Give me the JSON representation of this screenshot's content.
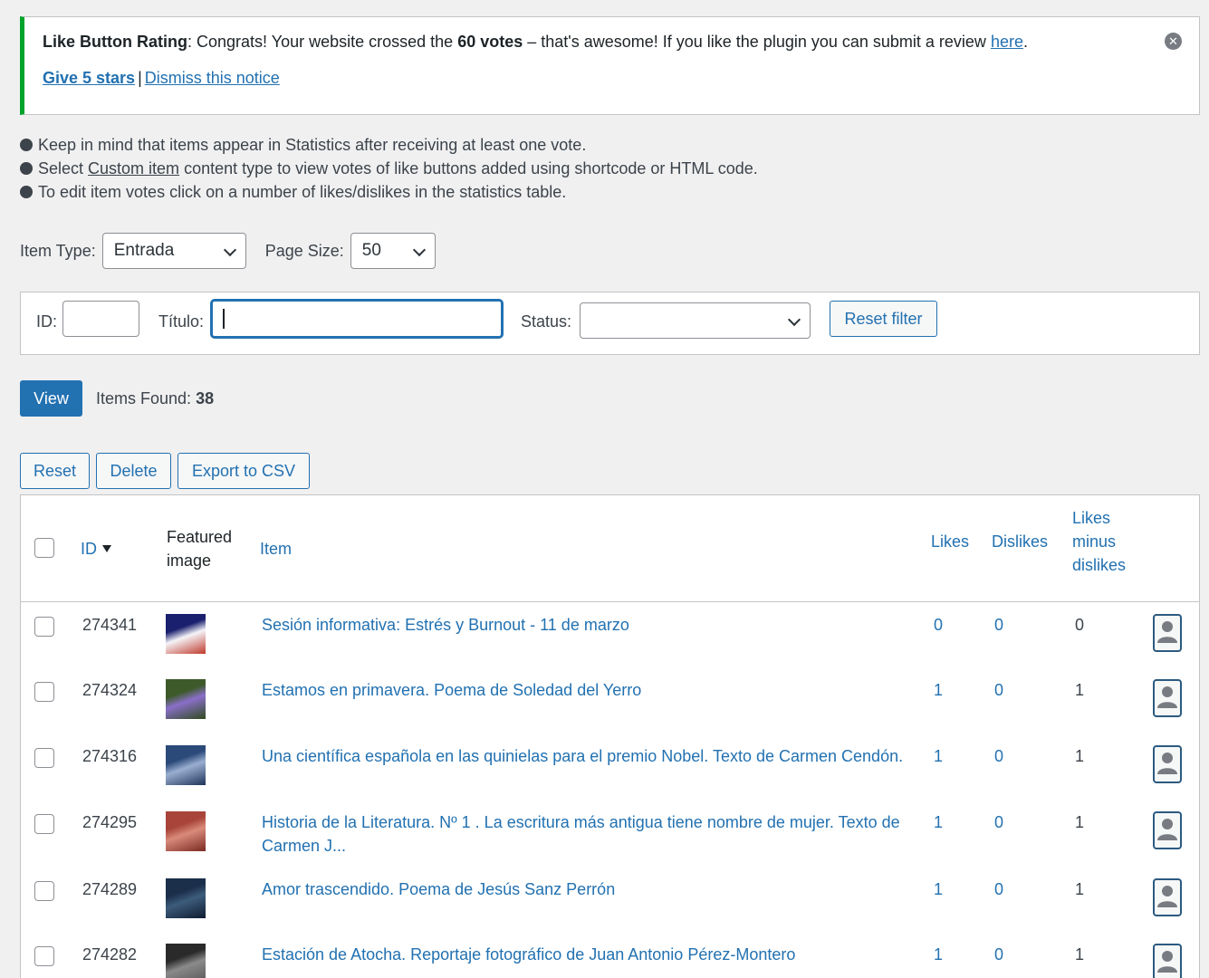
{
  "notice": {
    "plugin": "Like Button Rating",
    "colon": ":",
    "text_a": " Congrats! Your website crossed the ",
    "votes": "60 votes",
    "text_b": " – that's awesome! If you like the plugin you can submit a review ",
    "here_link": "here",
    "period": ".",
    "give_stars": "Give 5 stars",
    "separator": "|",
    "dismiss": "Dismiss this notice",
    "close_icon": "close-circle-icon"
  },
  "hints": [
    {
      "pre": "Keep in mind that items appear in Statistics after receiving at least one vote.",
      "link": "",
      "post": ""
    },
    {
      "pre": "Select ",
      "link": "Custom item",
      "post": " content type to view votes of like buttons added using shortcode or HTML code."
    },
    {
      "pre": "To edit item votes click on a number of likes/dislikes in the statistics table.",
      "link": "",
      "post": ""
    }
  ],
  "type_row": {
    "item_type_label": "Item Type:",
    "item_type_value": "Entrada",
    "page_size_label": "Page Size:",
    "page_size_value": "50"
  },
  "filter": {
    "id_label": "ID:",
    "id_value": "",
    "title_label": "Título:",
    "title_value": "",
    "status_label": "Status:",
    "status_value": "",
    "reset_label": "Reset filter"
  },
  "view": {
    "button": "View",
    "found_label": "Items Found: ",
    "found_count": "38"
  },
  "actions": {
    "reset": "Reset",
    "delete": "Delete",
    "export": "Export to CSV"
  },
  "table": {
    "headers": {
      "id": "ID",
      "featured_1": "Featured",
      "featured_2": "image",
      "item": "Item",
      "likes": "Likes",
      "dislikes": "Dislikes",
      "lmd_1": "Likes",
      "lmd_2": "minus",
      "lmd_3": "dislikes"
    },
    "rows": [
      {
        "id": "274341",
        "title": "Sesión informativa: Estrés y Burnout - 11 de marzo",
        "likes": "0",
        "dislikes": "0",
        "lmd": "0",
        "thumb_colors": [
          "#1a1f6e",
          "#f4f4f8",
          "#c0392b"
        ]
      },
      {
        "id": "274324",
        "title": "Estamos en primavera. Poema de Soledad del Yerro",
        "likes": "1",
        "dislikes": "0",
        "lmd": "1",
        "thumb_colors": [
          "#3d5a2a",
          "#8a6fc9",
          "#2f4a1e"
        ]
      },
      {
        "id": "274316",
        "title": "Una científica española en las quinielas para el premio Nobel. Texto de Carmen Cendón.",
        "likes": "1",
        "dislikes": "0",
        "lmd": "1",
        "thumb_colors": [
          "#2b4a7a",
          "#9aaed0",
          "#1d3358"
        ]
      },
      {
        "id": "274295",
        "title": "Historia de la Literatura. Nº 1 . La escritura más antigua tiene nombre de mujer. Texto de Carmen J...",
        "likes": "1",
        "dislikes": "0",
        "lmd": "1",
        "thumb_colors": [
          "#a8443a",
          "#d98a7a",
          "#7a2a22"
        ]
      },
      {
        "id": "274289",
        "title": "Amor trascendido. Poema de Jesús Sanz Perrón",
        "likes": "1",
        "dislikes": "0",
        "lmd": "1",
        "thumb_colors": [
          "#1b2e4a",
          "#3d5c7c",
          "#0f1c30"
        ]
      },
      {
        "id": "274282",
        "title": "Estación de Atocha. Reportaje fotográfico de Juan Antonio Pérez-Montero",
        "likes": "1",
        "dislikes": "0",
        "lmd": "1",
        "thumb_colors": [
          "#2a2a2a",
          "#8a8a8a",
          "#555555"
        ]
      }
    ]
  }
}
